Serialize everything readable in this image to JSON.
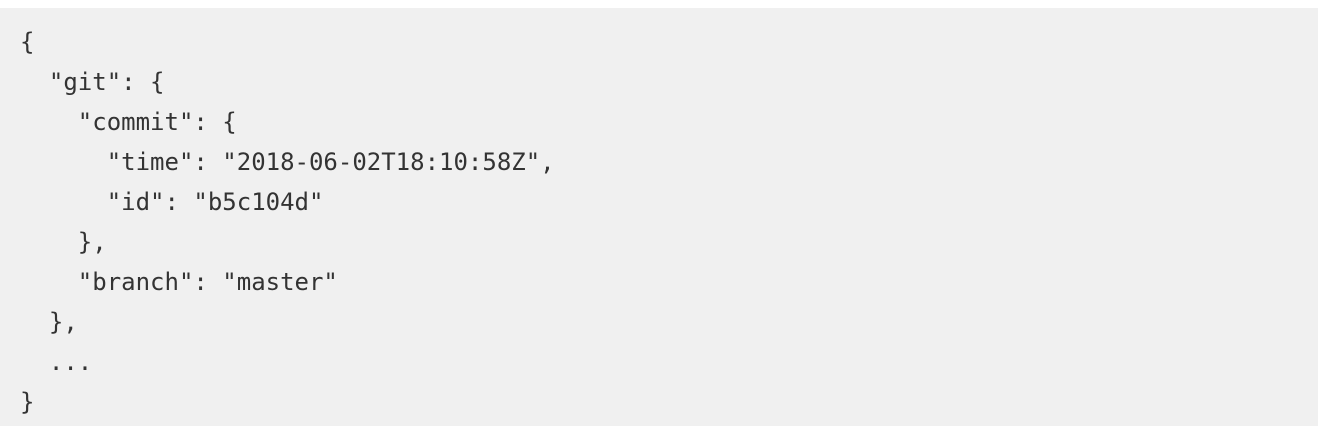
{
  "code": {
    "lines": [
      "{",
      "  \"git\": {",
      "    \"commit\": {",
      "      \"time\": \"2018-06-02T18:10:58Z\",",
      "      \"id\": \"b5c104d\"",
      "    },",
      "    \"branch\": \"master\"",
      "  },",
      "  ...",
      "}"
    ]
  },
  "colors": {
    "background": "#f0f0f0",
    "text": "#333333"
  }
}
